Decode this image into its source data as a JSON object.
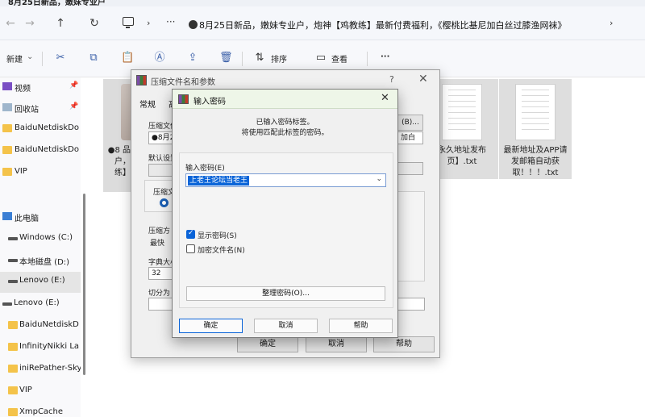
{
  "window": {
    "title_partial": "8月25日新品，嫩妹专业户",
    "address_path": "8月25日新品，嫩妹专业户，炮神【鸡教练】最新付费福利，《樱桃比基尼加白丝过膝渔网袜》"
  },
  "toolbar": {
    "new_label": "新建",
    "sort_label": "排序",
    "view_label": "查看",
    "more_label": "···"
  },
  "sidebar": {
    "items": [
      {
        "label": "视频",
        "icon": "video-icon"
      },
      {
        "label": "回收站",
        "icon": "recycle-bin-icon"
      },
      {
        "label": "BaiduNetdiskDo",
        "icon": "folder-icon"
      },
      {
        "label": "BaiduNetdiskDo",
        "icon": "folder-icon"
      },
      {
        "label": "VIP",
        "icon": "folder-icon"
      },
      {
        "label": "此电脑",
        "icon": "computer-icon"
      },
      {
        "label": "Windows (C:)",
        "icon": "drive-icon"
      },
      {
        "label": "本地磁盘 (D:)",
        "icon": "drive-icon"
      },
      {
        "label": "Lenovo (E:)",
        "icon": "drive-icon"
      },
      {
        "label": "Lenovo (E:)",
        "icon": "drive-icon"
      },
      {
        "label": "BaiduNetdiskD",
        "icon": "folder-icon"
      },
      {
        "label": "InfinityNikki La",
        "icon": "folder-icon"
      },
      {
        "label": "iniRePather-Sky",
        "icon": "folder-icon"
      },
      {
        "label": "VIP",
        "icon": "folder-icon"
      },
      {
        "label": "XmpCache",
        "icon": "folder-icon"
      }
    ]
  },
  "content": {
    "left_item_text": "●8 品，户，娘练】鸡",
    "files": [
      {
        "name": "永久地址发布页】.txt"
      },
      {
        "name": "最新地址及APP请发邮箱自动获取！！！.txt"
      }
    ]
  },
  "archive_dialog": {
    "title": "压缩文件名和参数",
    "help_glyph": "?",
    "tab_general": "常规",
    "tab_second": "高",
    "label_filename": "压缩文件",
    "filename_value": "●8月2",
    "browse_label": "(B)...",
    "label_default": "默认设置",
    "label_format": "压缩文",
    "label_method": "压缩方",
    "method_value": "最快",
    "label_dict": "字典大小",
    "dict_value": "32",
    "label_split": "切分为",
    "right_field_value": "加白",
    "ok_label": "确定",
    "cancel_label": "取消",
    "help_label": "帮助"
  },
  "password_dialog": {
    "title": "输入密码",
    "message_line1": "已输入密码标签。",
    "message_line2": "将使用匹配此标签的密码。",
    "password_label": "输入密码(E)",
    "password_value": "上老王论坛当老王",
    "show_password_label": "显示密码(S)",
    "show_password_checked": true,
    "encrypt_names_label": "加密文件名(N)",
    "encrypt_names_checked": false,
    "organize_label": "整理密码(O)...",
    "ok_label": "确定",
    "cancel_label": "取消",
    "help_label": "帮助"
  }
}
